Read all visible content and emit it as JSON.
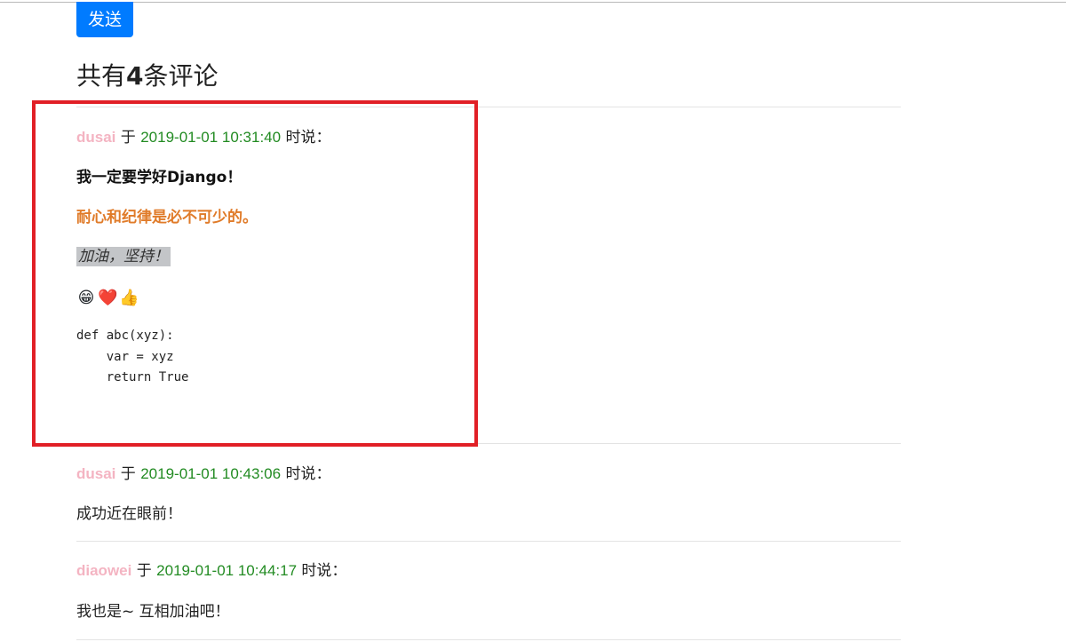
{
  "form": {
    "send_label": "发送"
  },
  "comments_header": {
    "prefix": "共有",
    "count": "4",
    "suffix": "条评论"
  },
  "comments": [
    {
      "author": "dusai",
      "on": " 于 ",
      "time": "2019-01-01 10:31:40",
      "said": " 时说：",
      "bold_text": "我一定要学好Django！",
      "orange_text": "耐心和纪律是必不可少的。",
      "italic_text": "加油，坚持！",
      "emojis": [
        "😁",
        "❤️",
        "👍"
      ],
      "code": "def abc(xyz):\n    var = xyz\n    return True"
    },
    {
      "author": "dusai",
      "on": " 于 ",
      "time": "2019-01-01 10:43:06",
      "said": " 时说：",
      "text": "成功近在眼前！"
    },
    {
      "author": "diaowei",
      "on": " 于 ",
      "time": "2019-01-01 10:44:17",
      "said": " 时说：",
      "text": "我也是~ 互相加油吧！"
    }
  ],
  "colors": {
    "button": "#007bff",
    "author": "#f4b4c2",
    "time": "#228b22",
    "emphasis": "#e07b29",
    "highlight_box": "#e11f26"
  }
}
